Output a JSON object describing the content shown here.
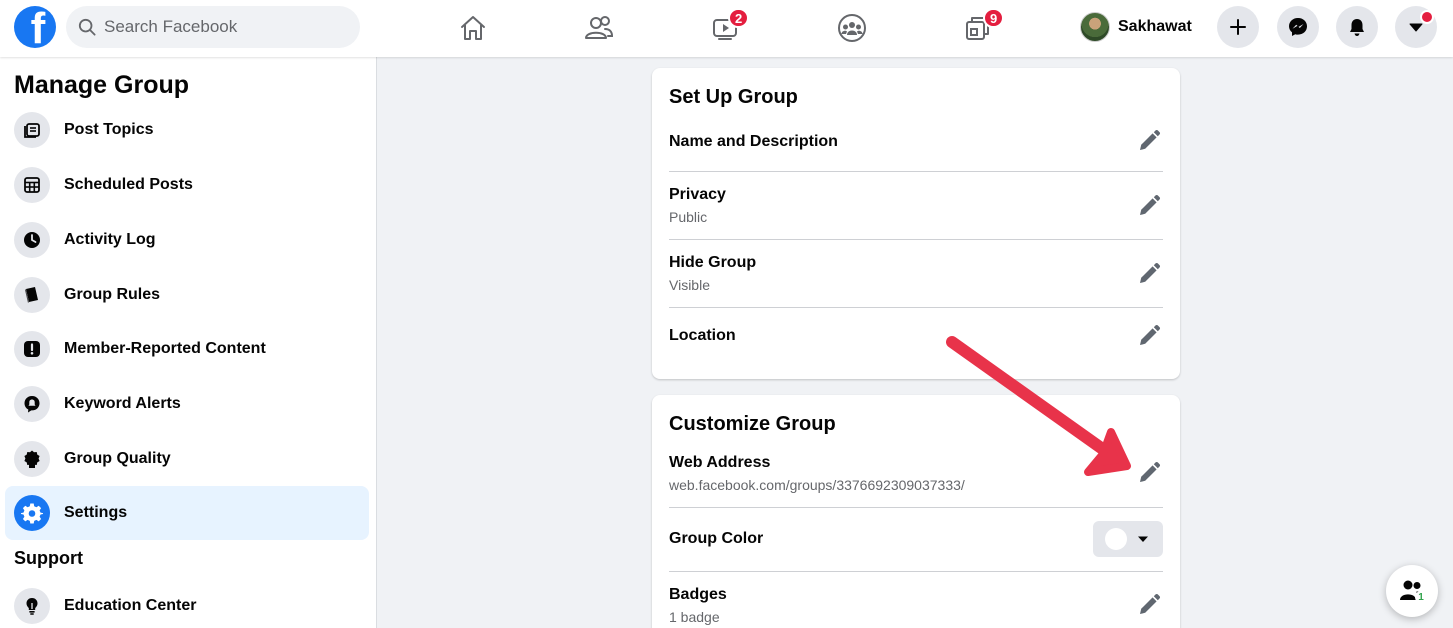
{
  "topbar": {
    "logo_letter": "f",
    "search_placeholder": "Search Facebook",
    "nav": [
      {
        "name": "home",
        "icon": "home-icon"
      },
      {
        "name": "friends",
        "icon": "friends-icon"
      },
      {
        "name": "watch",
        "icon": "watch-icon",
        "badge": "2"
      },
      {
        "name": "groups",
        "icon": "groups-icon"
      },
      {
        "name": "gaming",
        "icon": "gaming-icon",
        "badge": "9"
      }
    ],
    "profile_name": "Sakhawat",
    "actions": [
      "plus-icon",
      "messenger-icon",
      "bell-icon",
      "caret-down-icon"
    ]
  },
  "sidebar": {
    "title": "Manage Group",
    "items": [
      {
        "label": "Post Topics",
        "icon": "post-topics-icon"
      },
      {
        "label": "Scheduled Posts",
        "icon": "calendar-icon"
      },
      {
        "label": "Activity Log",
        "icon": "clock-icon"
      },
      {
        "label": "Group Rules",
        "icon": "book-icon"
      },
      {
        "label": "Member-Reported Content",
        "icon": "exclamation-icon"
      },
      {
        "label": "Keyword Alerts",
        "icon": "alert-bubble-icon"
      },
      {
        "label": "Group Quality",
        "icon": "badge-icon"
      },
      {
        "label": "Settings",
        "icon": "gear-icon",
        "active": true
      }
    ],
    "support_title": "Support",
    "support_items": [
      {
        "label": "Education Center",
        "icon": "lightbulb-icon"
      }
    ]
  },
  "setup": {
    "title": "Set Up Group",
    "rows": [
      {
        "label": "Name and Description",
        "sub": ""
      },
      {
        "label": "Privacy",
        "sub": "Public"
      },
      {
        "label": "Hide Group",
        "sub": "Visible"
      },
      {
        "label": "Location",
        "sub": ""
      }
    ]
  },
  "customize": {
    "title": "Customize Group",
    "rows": [
      {
        "label": "Web Address",
        "sub": "web.facebook.com/groups/3376692309037333/"
      },
      {
        "label": "Group Color",
        "sub": ""
      },
      {
        "label": "Badges",
        "sub": "1 badge"
      }
    ]
  },
  "float_button": {
    "count": "1"
  },
  "colors": {
    "brand": "#1877f2",
    "badge_red": "#e41e3f",
    "annotation_arrow": "#e8334a"
  }
}
